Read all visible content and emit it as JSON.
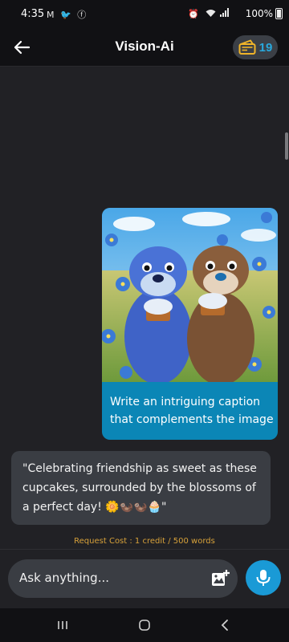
{
  "status": {
    "time": "4:35",
    "left_icons": [
      "gmail-icon",
      "twitter-icon",
      "facebook-icon"
    ],
    "right_icons": [
      "alarm-icon",
      "wifi-icon",
      "signal-icon"
    ],
    "battery": "100%"
  },
  "appbar": {
    "title": "Vision-Ai",
    "credits": "19",
    "back_icon": "arrow-left-icon",
    "credits_icon": "credit-card-icon"
  },
  "chat": {
    "user_message": {
      "image_description": "two otters holding cupcakes among blue flowers",
      "text": "Write an intriguing caption that complements the image"
    },
    "bot_message": {
      "text": "\"Celebrating friendship as sweet as these cupcakes, surrounded by the blossoms of a perfect day! 🌼🦦🦦🧁\""
    },
    "cost_note": "Request Cost : 1 credit / 500 words"
  },
  "composer": {
    "placeholder": "Ask anything...",
    "image_icon": "add-image-icon",
    "mic_icon": "microphone-icon"
  },
  "navbar": {
    "items": [
      "recent-apps-icon",
      "home-icon",
      "back-icon"
    ]
  },
  "colors": {
    "accent": "#1a9ad6",
    "user_bubble": "#0b86b6",
    "bot_bubble": "#3a3d43",
    "cost_text": "#d7a13a",
    "credits_text": "#29a9dd"
  }
}
